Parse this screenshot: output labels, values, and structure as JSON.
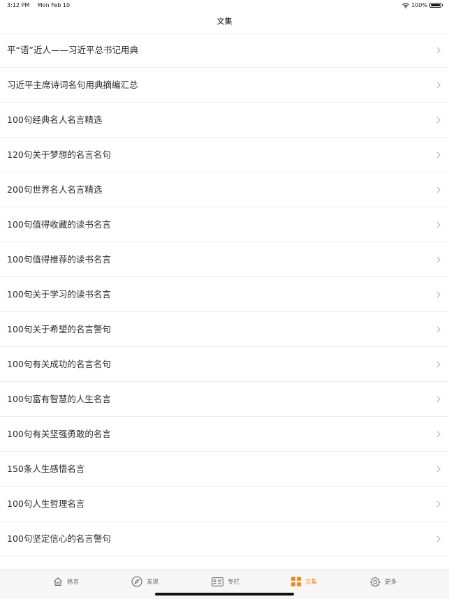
{
  "status_bar": {
    "time": "3:12 PM",
    "date": "Mon Feb 10",
    "battery": "100%"
  },
  "nav": {
    "title": "文集"
  },
  "list": {
    "items": [
      {
        "label": "平“语”近人——习近平总书记用典"
      },
      {
        "label": "习近平主席诗词名句用典摘编汇总"
      },
      {
        "label": "100句经典名人名言精选"
      },
      {
        "label": "120句关于梦想的名言名句"
      },
      {
        "label": "200句世界名人名言精选"
      },
      {
        "label": "100句值得收藏的读书名言"
      },
      {
        "label": "100句值得推荐的读书名言"
      },
      {
        "label": "100句关于学习的读书名言"
      },
      {
        "label": "100句关于希望的名言警句"
      },
      {
        "label": "100句有关成功的名言名句"
      },
      {
        "label": "100句富有智慧的人生名言"
      },
      {
        "label": "100句有关坚强勇敢的名言"
      },
      {
        "label": "150条人生感悟名言"
      },
      {
        "label": "100句人生哲理名言"
      },
      {
        "label": "100句坚定信心的名言警句"
      }
    ]
  },
  "tab_bar": {
    "tabs": [
      {
        "label": "格言",
        "icon": "home-icon",
        "active": false
      },
      {
        "label": "发现",
        "icon": "compass-icon",
        "active": false
      },
      {
        "label": "专栏",
        "icon": "list-card-icon",
        "active": false
      },
      {
        "label": "文集",
        "icon": "grid-icon",
        "active": true
      },
      {
        "label": "更多",
        "icon": "gear-icon",
        "active": false
      }
    ],
    "active_color": "#f08a24",
    "inactive_color": "#666666"
  }
}
